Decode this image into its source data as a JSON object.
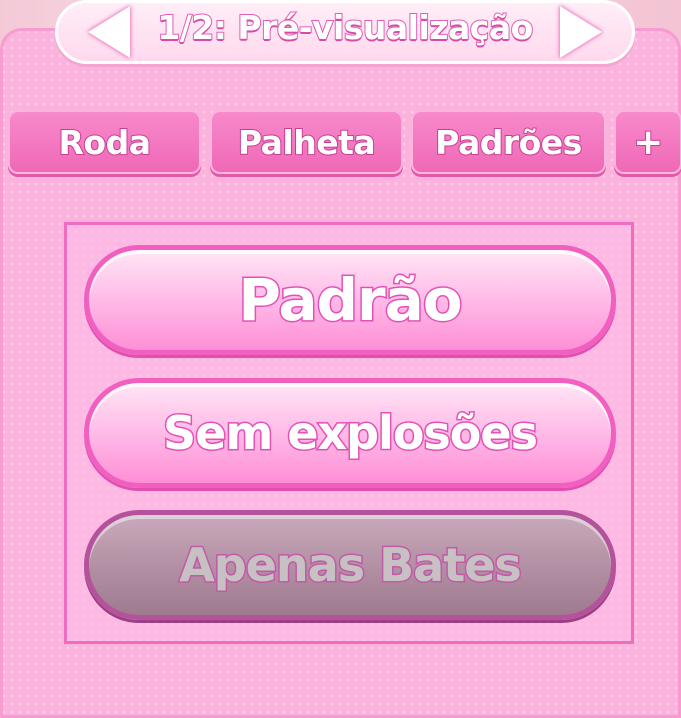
{
  "header": {
    "title": "1/2: Pré-visualização",
    "prev_icon": "triangle-left-icon",
    "next_icon": "triangle-right-icon"
  },
  "tabs": [
    {
      "label": "Roda"
    },
    {
      "label": "Palheta"
    },
    {
      "label": "Padrões"
    },
    {
      "label": "+"
    }
  ],
  "options": [
    {
      "label": "Padrão",
      "state": "enabled"
    },
    {
      "label": "Sem explosões",
      "state": "enabled"
    },
    {
      "label": "Apenas Bates",
      "state": "disabled"
    }
  ],
  "colors": {
    "panel": "#fbb3de",
    "tab": "#ef67b6",
    "accent_stroke": "#e451b5",
    "disabled": "#b28ea2"
  }
}
